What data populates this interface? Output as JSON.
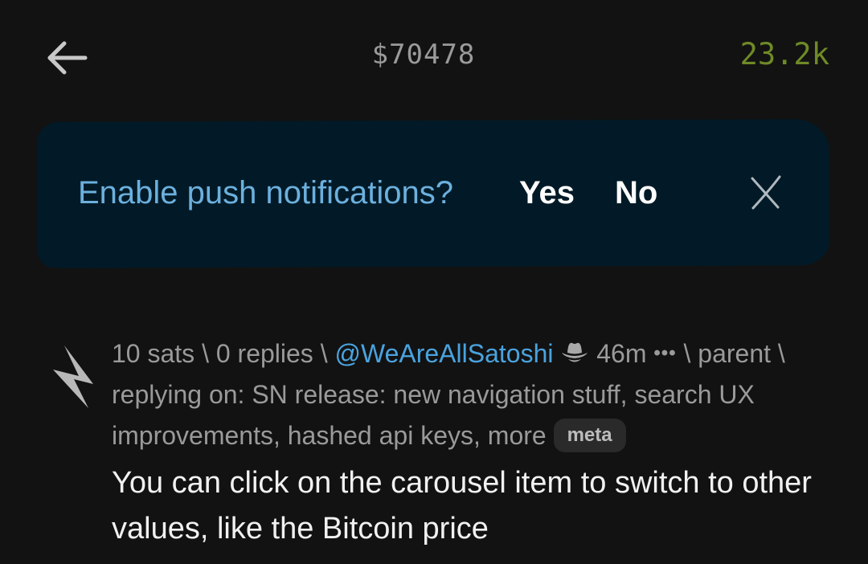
{
  "header": {
    "back_icon": "arrow-left-icon",
    "price": "$70478",
    "wallet_balance": "23.2k",
    "colors": {
      "price": "#9a9a9a",
      "wallet": "#6f8a26"
    }
  },
  "banner": {
    "prompt": "Enable push notifications?",
    "yes_label": "Yes",
    "no_label": "No",
    "close_icon": "close-icon",
    "colors": {
      "background": "#021a27",
      "prompt": "#6cb0de"
    }
  },
  "post": {
    "upvote_icon": "lightning-bolt-icon",
    "sats": "10 sats",
    "replies": "0 replies",
    "author": "@WeAreAllSatoshi",
    "author_icon": "cowboy-hat-icon",
    "age": "46m",
    "more_icon": "more-icon",
    "more": "•••",
    "parent": "parent",
    "replying_on_prefix": "replying on:",
    "replying_on_title": "SN release: new navigation stuff, search UX improvements, hashed api keys, more",
    "sep": "\\",
    "territory": "meta",
    "body": "You can click on the carousel item to switch to other values, like the Bitcoin price",
    "colors": {
      "author": "#4aa3df",
      "meta_text": "#9a9a9a"
    }
  }
}
